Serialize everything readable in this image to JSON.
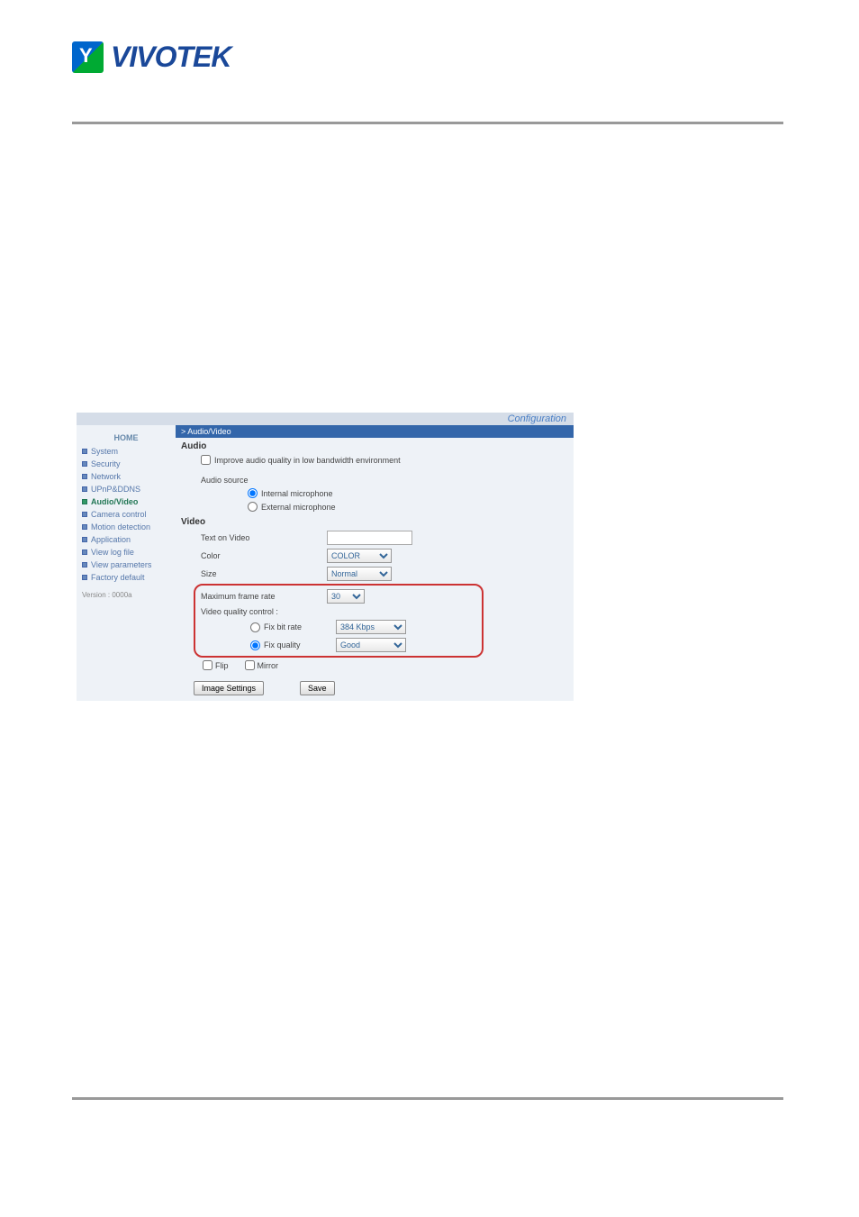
{
  "logo": {
    "text": "VIVOTEK"
  },
  "header": {
    "title": "Configuration"
  },
  "sidebar": {
    "home": "HOME",
    "items": [
      {
        "label": "System"
      },
      {
        "label": "Security"
      },
      {
        "label": "Network"
      },
      {
        "label": "UPnP&DDNS"
      },
      {
        "label": "Audio/Video"
      },
      {
        "label": "Camera control"
      },
      {
        "label": "Motion detection"
      },
      {
        "label": "Application"
      },
      {
        "label": "View log file"
      },
      {
        "label": "View parameters"
      },
      {
        "label": "Factory default"
      }
    ],
    "version": "Version : 0000a"
  },
  "tab": {
    "label": "> Audio/Video"
  },
  "audio": {
    "heading": "Audio",
    "improve_label": "Improve audio quality in low bandwidth environment",
    "source_label": "Audio source",
    "internal_label": "Internal microphone",
    "external_label": "External microphone"
  },
  "video": {
    "heading": "Video",
    "text_on_video_label": "Text on Video",
    "text_on_video_value": "",
    "color_label": "Color",
    "color_value": "COLOR",
    "size_label": "Size",
    "size_value": "Normal",
    "max_frame_label": "Maximum frame rate",
    "max_frame_value": "30",
    "quality_control_label": "Video quality control :",
    "fix_bitrate_label": "Fix bit rate",
    "fix_bitrate_value": "384 Kbps",
    "fix_quality_label": "Fix quality",
    "fix_quality_value": "Good",
    "flip_label": "Flip",
    "mirror_label": "Mirror"
  },
  "buttons": {
    "image_settings": "Image Settings",
    "save": "Save"
  }
}
